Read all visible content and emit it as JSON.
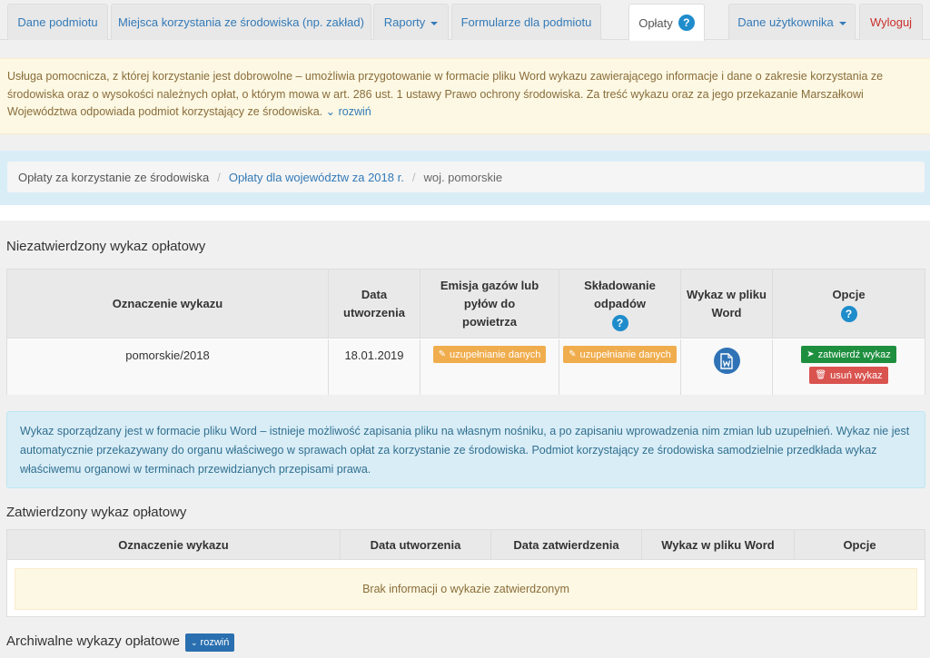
{
  "nav": {
    "tabs": [
      {
        "label": "Dane podmiotu"
      },
      {
        "label": "Miejsca korzystania ze środowiska (np. zakład)"
      },
      {
        "label": "Raporty"
      },
      {
        "label": "Formularze dla podmiotu"
      },
      {
        "label": "Opłaty"
      },
      {
        "label": "Dane użytkownika"
      },
      {
        "label": "Wyloguj"
      }
    ],
    "help_glyph": "?"
  },
  "notice": {
    "text": "Usługa pomocnicza, z której korzystanie jest dobrowolne – umożliwia przygotowanie w formacie pliku Word wykazu zawierającego informacje i dane o zakresie korzystania ze środowiska oraz o wysokości należnych opłat, o którym mowa w art. 286 ust. 1 ustawy Prawo ochrony środowiska. Za treść wykazu oraz za jego przekazanie Marszałkowi Województwa odpowiada podmiot korzystający ze środowiska.",
    "more": "rozwiń"
  },
  "breadcrumb": {
    "items": [
      "Opłaty za korzystanie ze środowiska",
      "Opłaty dla województw za 2018 r.",
      "woj. pomorskie"
    ],
    "separator": "/"
  },
  "unapproved": {
    "title": "Niezatwierdzony wykaz opłatowy",
    "headers": [
      "Oznaczenie wykazu",
      "Data utworzenia",
      "Emisja gazów lub pyłów do powietrza",
      "Składowanie odpadów",
      "Wykaz w pliku Word",
      "Opcje"
    ],
    "row": {
      "id": "pomorskie/2018",
      "date": "18.01.2019",
      "emission_btn": "uzupełnianie danych",
      "waste_btn": "uzupełnianie danych",
      "approve_btn": "zatwierdź wykaz",
      "delete_btn": "usuń wykaz"
    }
  },
  "info": {
    "text": "Wykaz sporządzany jest w formacie pliku Word – istnieje możliwość zapisania pliku na własnym nośniku, a po zapisaniu wprowadzenia nim zmian lub uzupełnień. Wykaz nie jest automatycznie przekazywany do organu właściwego w sprawach opłat za korzystanie ze środowiska. Podmiot korzystający ze środowiska samodzielnie przedkłada wykaz właściwemu organowi w terminach przewidzianych przepisami prawa."
  },
  "approved": {
    "title": "Zatwierdzony wykaz opłatowy",
    "headers": [
      "Oznaczenie wykazu",
      "Data utworzenia",
      "Data zatwierdzenia",
      "Wykaz w pliku Word",
      "Opcje"
    ],
    "empty": "Brak informacji o wykazie zatwierdzonym"
  },
  "archive": {
    "title": "Archiwalne wykazy opłatowe",
    "btn": "rozwiń"
  },
  "colors": {
    "link": "#337ab7",
    "warning_bg": "#fcf8e3",
    "info_bg": "#d9edf7",
    "orange": "#f0ad4e",
    "green": "#1e8f3e",
    "red": "#d9534f"
  }
}
